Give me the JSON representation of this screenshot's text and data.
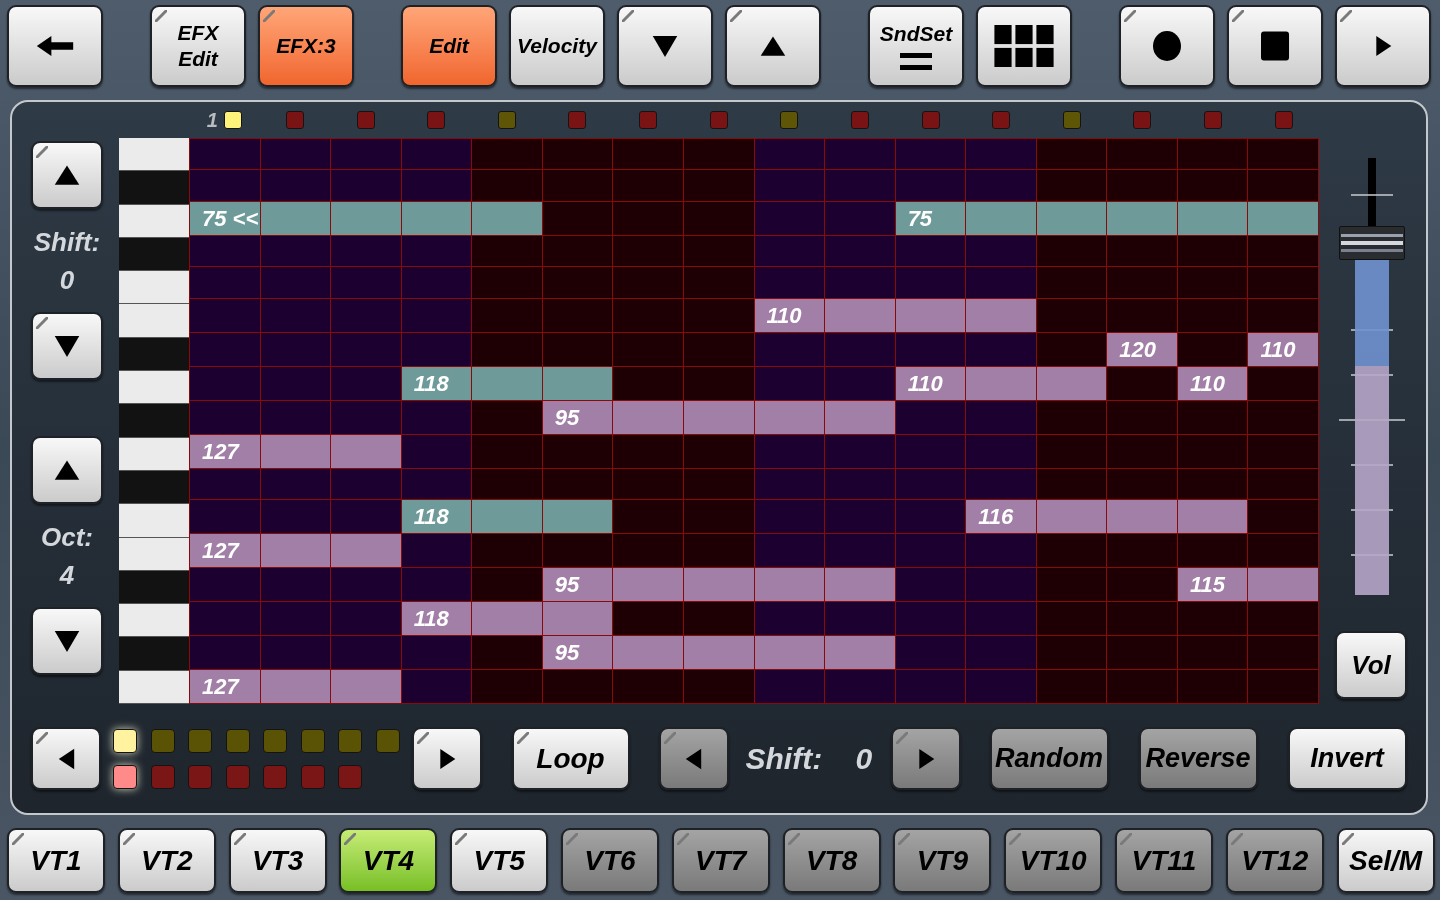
{
  "toolbar": [
    [
      {
        "kind": "back",
        "active": false,
        "corner_mark": false
      }
    ],
    [
      {
        "kind": "text",
        "label": "EFX\nEdit",
        "active": false,
        "corner_mark": true
      },
      {
        "kind": "text",
        "label": "EFX:3",
        "active": true,
        "corner_mark": true
      }
    ],
    [
      {
        "kind": "text",
        "label": "Edit",
        "active": true,
        "corner_mark": false
      },
      {
        "kind": "text",
        "label": "Velocity",
        "active": false,
        "corner_mark": false
      },
      {
        "kind": "down",
        "active": false,
        "corner_mark": true
      },
      {
        "kind": "up",
        "active": false,
        "corner_mark": true
      }
    ],
    [
      {
        "kind": "sndset",
        "label": "SndSet",
        "active": false,
        "corner_mark": false
      },
      {
        "kind": "grid",
        "active": false,
        "corner_mark": false
      }
    ],
    [
      {
        "kind": "record",
        "active": false,
        "corner_mark": true
      },
      {
        "kind": "stop",
        "active": false,
        "corner_mark": true
      },
      {
        "kind": "play",
        "active": false,
        "corner_mark": true
      }
    ]
  ],
  "shift_control": {
    "label": "Shift:",
    "value": "0"
  },
  "octave_control": {
    "label": "Oct:",
    "value": "4"
  },
  "step_label": "1",
  "step_leds": [
    {
      "color": "#fff27a"
    },
    {
      "color": "#7a1414"
    },
    {
      "color": "#7a1414"
    },
    {
      "color": "#7a1414"
    },
    {
      "color": "#5e5606"
    },
    {
      "color": "#7a1414"
    },
    {
      "color": "#7a1414"
    },
    {
      "color": "#7a1414"
    },
    {
      "color": "#5e5606"
    },
    {
      "color": "#7a1414"
    },
    {
      "color": "#7a1414"
    },
    {
      "color": "#7a1414"
    },
    {
      "color": "#5e5606"
    },
    {
      "color": "#7a1414"
    },
    {
      "color": "#7a1414"
    },
    {
      "color": "#7a1414"
    }
  ],
  "grid": {
    "rows": [
      {
        "kind": "white",
        "cells": [
          null,
          null,
          null,
          null,
          null,
          null,
          null,
          null,
          null,
          null,
          null,
          null,
          null,
          null,
          null,
          null
        ]
      },
      {
        "kind": "black",
        "cells": [
          null,
          null,
          null,
          null,
          null,
          null,
          null,
          null,
          null,
          null,
          null,
          null,
          null,
          null,
          null,
          null
        ]
      },
      {
        "kind": "white",
        "cells": [
          {
            "color": "#6f9a9a",
            "label": "75 <<"
          },
          {
            "color": "#6f9a9a"
          },
          {
            "color": "#6f9a9a"
          },
          {
            "color": "#6f9a9a"
          },
          {
            "color": "#6f9a9a"
          },
          null,
          null,
          null,
          null,
          null,
          {
            "color": "#6f9a9a",
            "label": "75"
          },
          {
            "color": "#6f9a9a"
          },
          {
            "color": "#6f9a9a"
          },
          {
            "color": "#6f9a9a"
          },
          {
            "color": "#6f9a9a"
          },
          {
            "color": "#6f9a9a"
          }
        ]
      },
      {
        "kind": "black",
        "cells": [
          null,
          null,
          null,
          null,
          null,
          null,
          null,
          null,
          null,
          null,
          null,
          null,
          null,
          null,
          null,
          null
        ]
      },
      {
        "kind": "white",
        "cells": [
          null,
          null,
          null,
          null,
          null,
          null,
          null,
          null,
          null,
          null,
          null,
          null,
          null,
          null,
          null,
          null
        ]
      },
      {
        "kind": "white",
        "cells": [
          null,
          null,
          null,
          null,
          null,
          null,
          null,
          null,
          {
            "color": "#a27fa6",
            "label": "110"
          },
          {
            "color": "#a27fa6"
          },
          {
            "color": "#a27fa6"
          },
          {
            "color": "#a27fa6"
          },
          null,
          null,
          null,
          null
        ]
      },
      {
        "kind": "black",
        "cells": [
          null,
          null,
          null,
          null,
          null,
          null,
          null,
          null,
          null,
          null,
          null,
          null,
          null,
          {
            "color": "#a27fa6",
            "label": "120"
          },
          null,
          {
            "color": "#a27fa6",
            "label": "110"
          }
        ]
      },
      {
        "kind": "white",
        "cells": [
          null,
          null,
          null,
          {
            "color": "#6f9a9a",
            "label": "118"
          },
          {
            "color": "#6f9a9a"
          },
          {
            "color": "#6f9a9a"
          },
          null,
          null,
          null,
          null,
          {
            "color": "#a27fa6",
            "label": "110"
          },
          {
            "color": "#a27fa6"
          },
          {
            "color": "#a27fa6"
          },
          null,
          {
            "color": "#a27fa6",
            "label": "110"
          },
          null
        ]
      },
      {
        "kind": "black",
        "cells": [
          null,
          null,
          null,
          null,
          null,
          {
            "color": "#a27fa6",
            "label": "95"
          },
          {
            "color": "#a27fa6"
          },
          {
            "color": "#a27fa6"
          },
          {
            "color": "#a27fa6"
          },
          {
            "color": "#a27fa6"
          },
          null,
          null,
          null,
          null,
          null,
          null
        ]
      },
      {
        "kind": "white",
        "cells": [
          {
            "color": "#a27fa6",
            "label": "127"
          },
          {
            "color": "#a27fa6"
          },
          {
            "color": "#a27fa6"
          },
          null,
          null,
          null,
          null,
          null,
          null,
          null,
          null,
          null,
          null,
          null,
          null,
          null
        ]
      },
      {
        "kind": "black",
        "cells": [
          null,
          null,
          null,
          null,
          null,
          null,
          null,
          null,
          null,
          null,
          null,
          null,
          null,
          null,
          null,
          null
        ]
      },
      {
        "kind": "white",
        "cells": [
          null,
          null,
          null,
          {
            "color": "#6f9a9a",
            "label": "118"
          },
          {
            "color": "#6f9a9a"
          },
          {
            "color": "#6f9a9a"
          },
          null,
          null,
          null,
          null,
          null,
          {
            "color": "#a27fa6",
            "label": "116"
          },
          {
            "color": "#a27fa6"
          },
          {
            "color": "#a27fa6"
          },
          {
            "color": "#a27fa6"
          },
          null
        ]
      },
      {
        "kind": "white",
        "cells": [
          {
            "color": "#a27fa6",
            "label": "127"
          },
          {
            "color": "#a27fa6"
          },
          {
            "color": "#a27fa6"
          },
          null,
          null,
          null,
          null,
          null,
          null,
          null,
          null,
          null,
          null,
          null,
          null,
          null
        ]
      },
      {
        "kind": "black",
        "cells": [
          null,
          null,
          null,
          null,
          null,
          {
            "color": "#a27fa6",
            "label": "95"
          },
          {
            "color": "#a27fa6"
          },
          {
            "color": "#a27fa6"
          },
          {
            "color": "#a27fa6"
          },
          {
            "color": "#a27fa6"
          },
          null,
          null,
          null,
          null,
          {
            "color": "#a27fa6",
            "label": "115"
          },
          {
            "color": "#a27fa6"
          }
        ]
      },
      {
        "kind": "white",
        "cells": [
          null,
          null,
          null,
          {
            "color": "#a27fa6",
            "label": "118"
          },
          {
            "color": "#a27fa6"
          },
          {
            "color": "#a27fa6"
          },
          null,
          null,
          null,
          null,
          null,
          null,
          null,
          null,
          null,
          null
        ]
      },
      {
        "kind": "black",
        "cells": [
          null,
          null,
          null,
          null,
          null,
          {
            "color": "#a27fa6",
            "label": "95"
          },
          {
            "color": "#a27fa6"
          },
          {
            "color": "#a27fa6"
          },
          {
            "color": "#a27fa6"
          },
          {
            "color": "#a27fa6"
          },
          null,
          null,
          null,
          null,
          null,
          null
        ]
      },
      {
        "kind": "white",
        "cells": [
          {
            "color": "#a27fa6",
            "label": "127"
          },
          {
            "color": "#a27fa6"
          },
          {
            "color": "#a27fa6"
          },
          null,
          null,
          null,
          null,
          null,
          null,
          null,
          null,
          null,
          null,
          null,
          null,
          null
        ]
      }
    ]
  },
  "volume": {
    "level": 0.8,
    "label": "Vol"
  },
  "pattern": {
    "leds_top": [
      {
        "lit": true
      },
      {
        "lit": false
      },
      {
        "lit": false
      },
      {
        "lit": false
      },
      {
        "lit": false
      },
      {
        "lit": false
      },
      {
        "lit": false
      },
      {
        "lit": false
      }
    ],
    "leds_bottom": [
      {
        "lit": true
      },
      {
        "lit": false
      },
      {
        "lit": false
      },
      {
        "lit": false
      },
      {
        "lit": false
      },
      {
        "lit": false
      },
      {
        "lit": false
      }
    ]
  },
  "loop_button": {
    "label": "Loop"
  },
  "step_shift": {
    "label": "Shift:",
    "value": "0",
    "enabled": false
  },
  "actions": [
    {
      "label": "Random",
      "enabled": false
    },
    {
      "label": "Reverse",
      "enabled": false
    },
    {
      "label": "Invert",
      "enabled": true
    }
  ],
  "tabs": [
    {
      "label": "VT1",
      "selected": false,
      "enabled": true
    },
    {
      "label": "VT2",
      "selected": false,
      "enabled": true
    },
    {
      "label": "VT3",
      "selected": false,
      "enabled": true
    },
    {
      "label": "VT4",
      "selected": true,
      "enabled": true
    },
    {
      "label": "VT5",
      "selected": false,
      "enabled": true
    },
    {
      "label": "VT6",
      "selected": false,
      "enabled": false
    },
    {
      "label": "VT7",
      "selected": false,
      "enabled": false
    },
    {
      "label": "VT8",
      "selected": false,
      "enabled": false
    },
    {
      "label": "VT9",
      "selected": false,
      "enabled": false
    },
    {
      "label": "VT10",
      "selected": false,
      "enabled": false
    },
    {
      "label": "VT11",
      "selected": false,
      "enabled": false
    },
    {
      "label": "VT12",
      "selected": false,
      "enabled": false
    },
    {
      "label": "Sel/M",
      "selected": false,
      "enabled": true
    }
  ]
}
